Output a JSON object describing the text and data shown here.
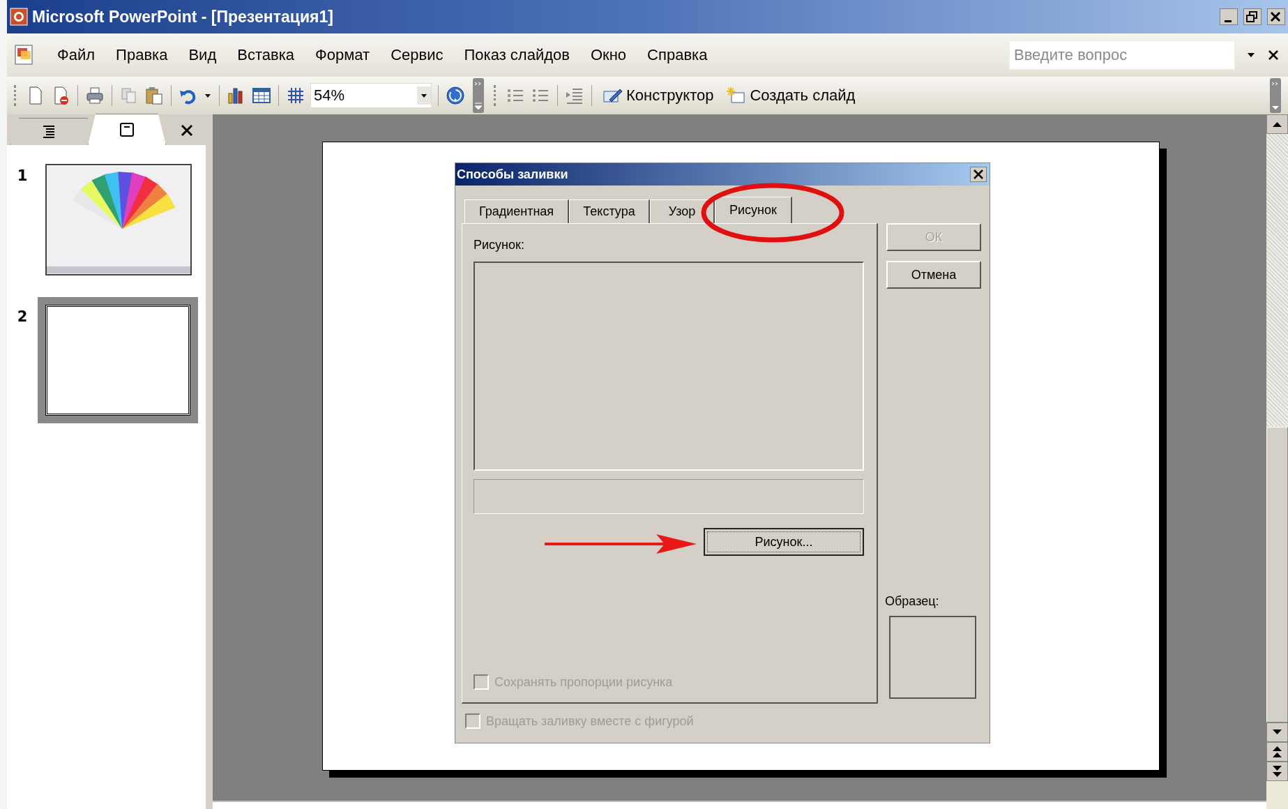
{
  "window": {
    "title": "Microsoft PowerPoint - [Презентация1]"
  },
  "menu": [
    {
      "label": "Файл"
    },
    {
      "label": "Правка"
    },
    {
      "label": "Вид"
    },
    {
      "label": "Вставка"
    },
    {
      "label": "Формат"
    },
    {
      "label": "Сервис"
    },
    {
      "label": "Показ слайдов"
    },
    {
      "label": "Окно"
    },
    {
      "label": "Справка"
    }
  ],
  "help_search": {
    "placeholder": "Введите вопрос"
  },
  "toolbar": {
    "zoom": "54%",
    "buttons": [
      {
        "kind": "design",
        "label": "Конструктор"
      },
      {
        "kind": "new_slide",
        "label": "Создать слайд"
      }
    ]
  },
  "pane_tabs": [
    {
      "kind": "outline",
      "selected": false
    },
    {
      "kind": "slides",
      "selected": true
    }
  ],
  "slides": [
    {
      "number": "1",
      "selected": false,
      "kind": "picture"
    },
    {
      "number": "2",
      "selected": true,
      "kind": "blank"
    }
  ],
  "dialog": {
    "title": "Способы заливки",
    "tabs": [
      {
        "label": "Градиентная",
        "selected": false
      },
      {
        "label": "Текстура",
        "selected": false
      },
      {
        "label": "Узор",
        "selected": false
      },
      {
        "label": "Рисунок",
        "selected": true
      }
    ],
    "picture_label": "Рисунок:",
    "select_button": "Рисунок...",
    "keep_ratio": {
      "label": "Сохранять пропорции рисунка",
      "checked": false,
      "disabled": true
    },
    "rotate_with_shape": {
      "label": "Вращать заливку вместе с фигурой",
      "checked": false,
      "disabled": true
    },
    "buttons": [
      {
        "label": "ОК",
        "disabled": true
      },
      {
        "label": "Отмена",
        "disabled": false
      }
    ],
    "sample_label": "Образец:"
  },
  "annotations": {
    "tab_circle": true,
    "button_arrow": true
  }
}
